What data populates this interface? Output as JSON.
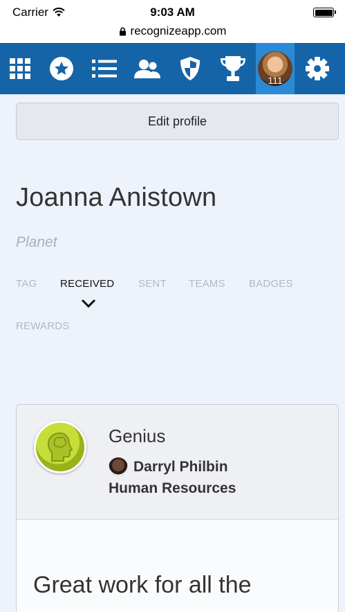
{
  "status_bar": {
    "carrier": "Carrier",
    "time": "9:03 AM",
    "url": "recognizeapp.com"
  },
  "nav": {
    "items": [
      {
        "icon": "grid-icon"
      },
      {
        "icon": "star-icon"
      },
      {
        "icon": "list-icon"
      },
      {
        "icon": "people-icon"
      },
      {
        "icon": "shield-icon"
      },
      {
        "icon": "trophy-icon"
      }
    ],
    "avatar_count": "111",
    "settings_icon": "gear-icon",
    "accent_color": "#1564a7",
    "active_color": "#2a8ad6"
  },
  "profile": {
    "edit_label": "Edit profile",
    "name": "Joanna Anistown",
    "company": "Planet"
  },
  "tabs": [
    {
      "label": "TAG",
      "active": false
    },
    {
      "label": "RECEIVED",
      "active": true
    },
    {
      "label": "SENT",
      "active": false
    },
    {
      "label": "TEAMS",
      "active": false
    },
    {
      "label": "BADGES",
      "active": false
    },
    {
      "label": "REWARDS",
      "active": false
    }
  ],
  "recognition": {
    "badge_name": "Genius",
    "sender_name": "Darryl Philbin",
    "sender_department": "Human Resources",
    "message": "Great work for all the"
  }
}
